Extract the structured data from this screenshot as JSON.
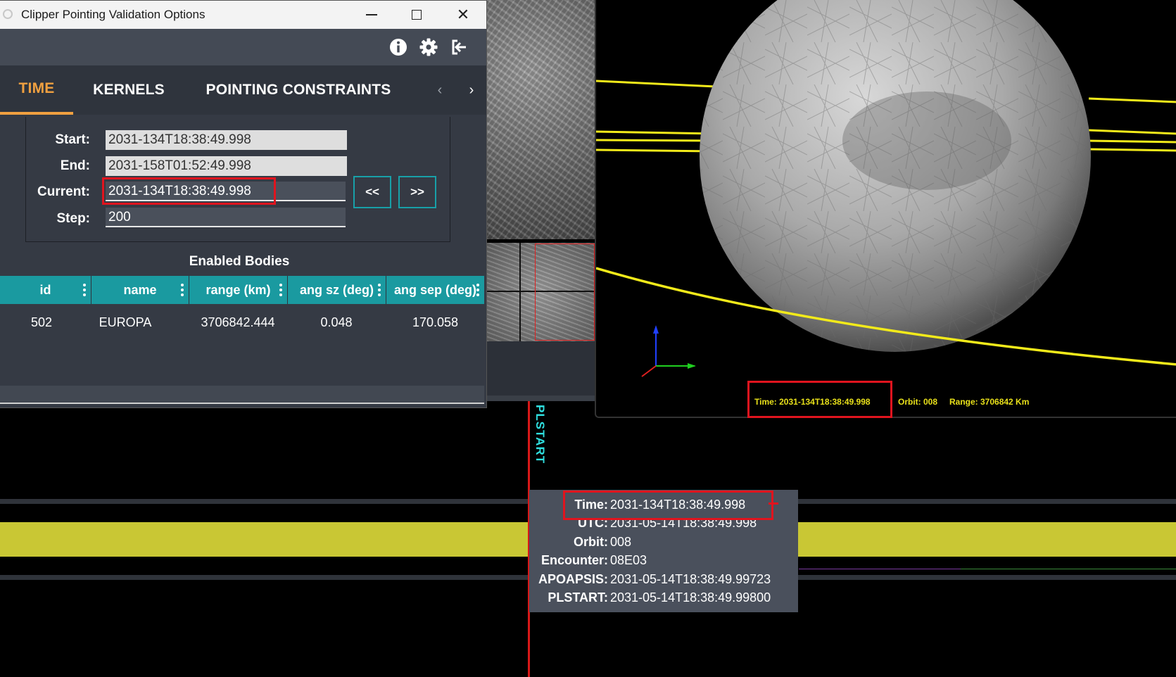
{
  "window": {
    "title": "Clipper Pointing Validation Options",
    "minimize_glyph": "",
    "close_glyph": "✕"
  },
  "toolbar": {
    "icons": [
      "info-icon",
      "gear-icon",
      "exit-icon"
    ]
  },
  "tabs": {
    "items": [
      {
        "label": "TIME",
        "active": true
      },
      {
        "label": "KERNELS",
        "active": false
      },
      {
        "label": "POINTING CONSTRAINTS",
        "active": false
      }
    ],
    "prev": "‹",
    "next": "›"
  },
  "time": {
    "start_label": "Start:",
    "start_value": "2031-134T18:38:49.998",
    "end_label": "End:",
    "end_value": "2031-158T01:52:49.998",
    "current_label": "Current:",
    "current_value": "2031-134T18:38:49.998",
    "step_label": "Step:",
    "step_value": "200",
    "back_button": "<<",
    "forward_button": ">>"
  },
  "bodies": {
    "title": "Enabled Bodies",
    "columns": [
      "id",
      "name",
      "range (km)",
      "ang sz (deg)",
      "ang sep (deg)"
    ],
    "rows": [
      [
        "502",
        "EUROPA",
        "3706842.444",
        "0.048",
        "170.058"
      ]
    ]
  },
  "view3d": {
    "hud_time": "Time: 2031-134T18:38:49.998",
    "hud_orbit": "Orbit: 008",
    "hud_range": "Range: 3706842 Km",
    "accent": "#e8e01a"
  },
  "timeline": {
    "cursor_label": "PLSTART",
    "band_color": "#c9c734",
    "tooltip": [
      {
        "key": "Time:",
        "value": "2031-134T18:38:49.998"
      },
      {
        "key": "UTC:",
        "value": "2031-05-14T18:38:49.998"
      },
      {
        "key": "Orbit:",
        "value": "008"
      },
      {
        "key": "Encounter:",
        "value": "08E03"
      },
      {
        "key": "APOAPSIS:",
        "value": "2031-05-14T18:38:49.99723"
      },
      {
        "key": "PLSTART:",
        "value": "2031-05-14T18:38:49.99800"
      }
    ]
  }
}
